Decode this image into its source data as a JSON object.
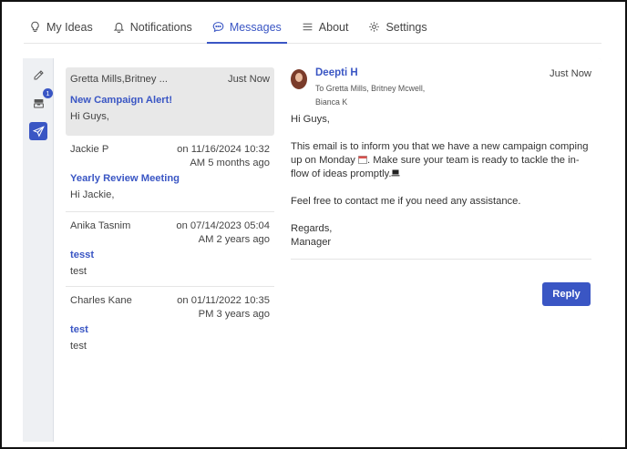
{
  "nav": {
    "tabs": [
      {
        "label": "My Ideas",
        "icon": "lightbulb-icon"
      },
      {
        "label": "Notifications",
        "icon": "bell-icon"
      },
      {
        "label": "Messages",
        "icon": "chat-icon",
        "active": true
      },
      {
        "label": "About",
        "icon": "menu-lines-icon"
      },
      {
        "label": "Settings",
        "icon": "gear-icon"
      }
    ]
  },
  "rail": {
    "compose_icon": "pencil-icon",
    "inbox_icon": "inbox-icon",
    "inbox_badge": "1",
    "sent_icon": "paper-plane-icon"
  },
  "messages": [
    {
      "from": "Gretta Mills,Britney ...",
      "when": "Just Now",
      "subject": "New Campaign Alert!",
      "preview": "Hi Guys,"
    },
    {
      "from": "Jackie P",
      "when": "on 11/16/2024 10:32 AM 5 months ago",
      "subject": "Yearly Review Meeting",
      "preview": "Hi Jackie,"
    },
    {
      "from": "Anika Tasnim",
      "when": "on 07/14/2023 05:04 AM 2 years ago",
      "subject": "tesst",
      "preview": "test"
    },
    {
      "from": "Charles Kane",
      "when": "on 01/11/2022 10:35 PM 3 years ago",
      "subject": "test",
      "preview": "test"
    }
  ],
  "detail": {
    "sender": "Deepti H",
    "to": "To Gretta Mills, Britney Mcwell, Bianca K",
    "time": "Just Now",
    "greeting": "Hi Guys,",
    "body_part1": "This email is to inform you that we have a new campaign comping up on Monday",
    "body_part2": ". Make sure your team is ready to tackle the in-flow of ideas promptly.",
    "closing": "Feel free to contact me if you need any assistance.",
    "signoff": "Regards,",
    "signature": "Manager",
    "reply_label": "Reply"
  },
  "colors": {
    "accent": "#3a56c4",
    "panel_bg": "#eef0f3",
    "selected_bg": "#e8e8e8"
  }
}
